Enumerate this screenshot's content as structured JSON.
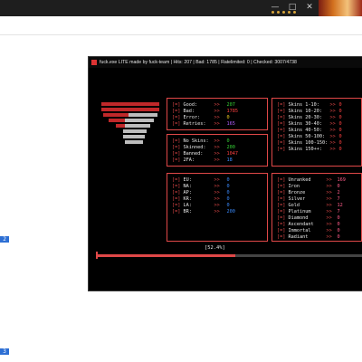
{
  "background_window": {
    "controls": [
      "—",
      "□",
      "✕"
    ]
  },
  "left_chips": [
    "2",
    "3"
  ],
  "console": {
    "title": "fuck.exe LITE made by fuck-team | Hits: 207 | Bad: 1785 | Ratelimited: 0 | Checked: 3007/4738",
    "colors": {
      "border": "#e04848",
      "label": "#e8e8e8",
      "bg": "#000000"
    },
    "stats_panel": [
      {
        "label": "Good:",
        "value": "207",
        "color": "#36d336"
      },
      {
        "label": "Bad:",
        "value": "1785",
        "color": "#ff4040"
      },
      {
        "label": "Error:",
        "value": "0",
        "color": "#f0d020"
      },
      {
        "label": "Retries:",
        "value": "165",
        "color": "#b060ff"
      }
    ],
    "account_panel": [
      {
        "label": "No Skins:",
        "value": "0",
        "color": "#36d336"
      },
      {
        "label": "Skinned:",
        "value": "200",
        "color": "#36d336"
      },
      {
        "label": "Banned:",
        "value": "1047",
        "color": "#ff4040"
      },
      {
        "label": "2FA:",
        "value": "18",
        "color": "#3b8cff"
      }
    ],
    "skins_panel": [
      {
        "label": "Skins 1-10:",
        "value": "0",
        "color": "#ff4040"
      },
      {
        "label": "Skins 10-20:",
        "value": "0",
        "color": "#ff4040"
      },
      {
        "label": "Skins 20-30:",
        "value": "0",
        "color": "#ff4040"
      },
      {
        "label": "Skins 30-40:",
        "value": "0",
        "color": "#ff4040"
      },
      {
        "label": "Skins 40-50:",
        "value": "0",
        "color": "#ff4040"
      },
      {
        "label": "Skins 50-100:",
        "value": "0",
        "color": "#ff4040"
      },
      {
        "label": "Skins 100-150:",
        "value": "0",
        "color": "#ff4040"
      },
      {
        "label": "Skins 150++:",
        "value": "0",
        "color": "#ff4040"
      }
    ],
    "region_panel": [
      {
        "label": "EU:",
        "value": "0",
        "color": "#3b8cff"
      },
      {
        "label": "NA:",
        "value": "0",
        "color": "#3b8cff"
      },
      {
        "label": "AP:",
        "value": "0",
        "color": "#3b8cff"
      },
      {
        "label": "KR:",
        "value": "0",
        "color": "#3b8cff"
      },
      {
        "label": "LA:",
        "value": "0",
        "color": "#3b8cff"
      },
      {
        "label": "BR:",
        "value": "200",
        "color": "#3b8cff"
      }
    ],
    "rank_panel": [
      {
        "label": "Unranked",
        "value": "169",
        "color": "#ff5c8a"
      },
      {
        "label": "Iron",
        "value": "0",
        "color": "#ff5c8a"
      },
      {
        "label": "Bronze",
        "value": "2",
        "color": "#ff5c8a"
      },
      {
        "label": "Silver",
        "value": "7",
        "color": "#ff5c8a"
      },
      {
        "label": "Gold",
        "value": "12",
        "color": "#ff5c8a"
      },
      {
        "label": "Platinum",
        "value": "7",
        "color": "#ff5c8a"
      },
      {
        "label": "Diamond",
        "value": "0",
        "color": "#ff5c8a"
      },
      {
        "label": "Ascendant",
        "value": "0",
        "color": "#ff5c8a"
      },
      {
        "label": "Immortal",
        "value": "0",
        "color": "#ff5c8a"
      },
      {
        "label": "Radiant",
        "value": "0",
        "color": "#ff5c8a"
      }
    ],
    "progress": {
      "label": "[52.4%]",
      "fraction": 0.524
    }
  }
}
